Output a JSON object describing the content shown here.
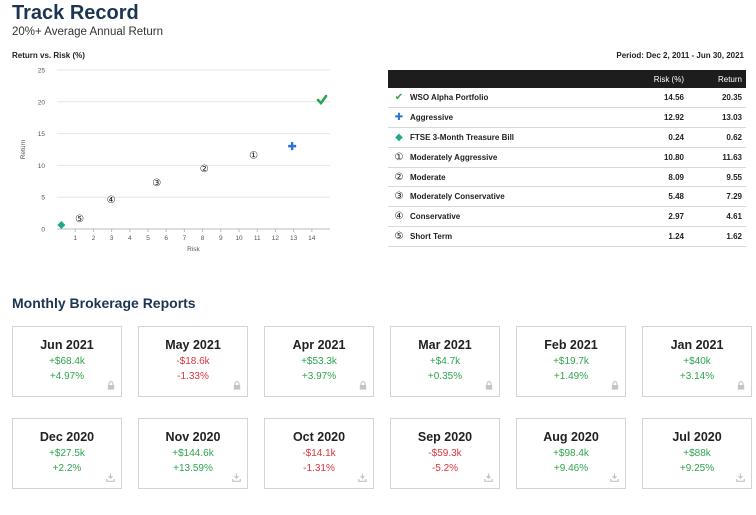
{
  "header": {
    "title": "Track Record",
    "subtitle": "20%+ Average Annual Return"
  },
  "chart_header": {
    "title": "Return vs. Risk (%)",
    "period": "Period: Dec 2, 2011 - Jun 30, 2021"
  },
  "chart_data": {
    "type": "scatter",
    "title": "Return vs. Risk (%)",
    "xlabel": "Risk",
    "ylabel": "Return",
    "xlim": [
      0,
      15
    ],
    "ylim": [
      0,
      25
    ],
    "x_ticks": [
      "1",
      "2",
      "3",
      "4",
      "5",
      "6",
      "7",
      "8",
      "9",
      "10",
      "11",
      "12",
      "13",
      "14"
    ],
    "y_ticks": [
      "0",
      "5",
      "10",
      "15",
      "20",
      "25"
    ],
    "grid": "horizontal",
    "series": [
      {
        "name": "WSO Alpha Portfolio",
        "marker": "check",
        "color": "#2da44e",
        "x": 14.56,
        "y": 20.35
      },
      {
        "name": "Aggressive",
        "marker": "plus",
        "color": "#2f6fd9",
        "x": 12.92,
        "y": 13.03
      },
      {
        "name": "FTSE 3-Month Treasure Bill",
        "marker": "diamond",
        "color": "#1fa88a",
        "x": 0.24,
        "y": 0.62
      },
      {
        "name": "Moderately Aggressive",
        "marker": "①",
        "color": "#111111",
        "x": 10.8,
        "y": 11.63
      },
      {
        "name": "Moderate",
        "marker": "②",
        "color": "#111111",
        "x": 8.09,
        "y": 9.55
      },
      {
        "name": "Moderately Conservative",
        "marker": "③",
        "color": "#111111",
        "x": 5.48,
        "y": 7.29
      },
      {
        "name": "Conservative",
        "marker": "④",
        "color": "#111111",
        "x": 2.97,
        "y": 4.61
      },
      {
        "name": "Short Term",
        "marker": "⑤",
        "color": "#111111",
        "x": 1.24,
        "y": 1.62
      }
    ]
  },
  "table": {
    "col_risk": "Risk (%)",
    "col_return": "Return",
    "rows": [
      {
        "icon": "✔",
        "color": "#2da44e",
        "name": "WSO Alpha Portfolio",
        "risk": "14.56",
        "ret": "20.35"
      },
      {
        "icon": "✚",
        "color": "#2f6fd9",
        "name": "Aggressive",
        "risk": "12.92",
        "ret": "13.03"
      },
      {
        "icon": "◆",
        "color": "#1fa88a",
        "name": "FTSE 3-Month Treasure Bill",
        "risk": "0.24",
        "ret": "0.62"
      },
      {
        "icon": "①",
        "color": "#111111",
        "name": "Moderately Aggressive",
        "risk": "10.80",
        "ret": "11.63"
      },
      {
        "icon": "②",
        "color": "#111111",
        "name": "Moderate",
        "risk": "8.09",
        "ret": "9.55"
      },
      {
        "icon": "③",
        "color": "#111111",
        "name": "Moderately Conservative",
        "risk": "5.48",
        "ret": "7.29"
      },
      {
        "icon": "④",
        "color": "#111111",
        "name": "Conservative",
        "risk": "2.97",
        "ret": "4.61"
      },
      {
        "icon": "⑤",
        "color": "#111111",
        "name": "Short Term",
        "risk": "1.24",
        "ret": "1.62"
      }
    ]
  },
  "reports": {
    "title": "Monthly Brokerage Reports",
    "cards": [
      {
        "month": "Jun 2021",
        "amount": "+$68.4k",
        "pct": "+4.97%",
        "sign": "pos",
        "icon": "lock-icon"
      },
      {
        "month": "May 2021",
        "amount": "-$18.6k",
        "pct": "-1.33%",
        "sign": "neg",
        "icon": "lock-icon"
      },
      {
        "month": "Apr 2021",
        "amount": "+$53.3k",
        "pct": "+3.97%",
        "sign": "pos",
        "icon": "lock-icon"
      },
      {
        "month": "Mar 2021",
        "amount": "+$4.7k",
        "pct": "+0.35%",
        "sign": "pos",
        "icon": "lock-icon"
      },
      {
        "month": "Feb 2021",
        "amount": "+$19.7k",
        "pct": "+1.49%",
        "sign": "pos",
        "icon": "lock-icon"
      },
      {
        "month": "Jan 2021",
        "amount": "+$40k",
        "pct": "+3.14%",
        "sign": "pos",
        "icon": "lock-icon"
      },
      {
        "month": "Dec 2020",
        "amount": "+$27.5k",
        "pct": "+2.2%",
        "sign": "pos",
        "icon": "download-icon"
      },
      {
        "month": "Nov 2020",
        "amount": "+$144.6k",
        "pct": "+13.59%",
        "sign": "pos",
        "icon": "download-icon"
      },
      {
        "month": "Oct 2020",
        "amount": "-$14.1k",
        "pct": "-1.31%",
        "sign": "neg",
        "icon": "download-icon"
      },
      {
        "month": "Sep 2020",
        "amount": "-$59.3k",
        "pct": "-5.2%",
        "sign": "neg",
        "icon": "download-icon"
      },
      {
        "month": "Aug 2020",
        "amount": "+$98.4k",
        "pct": "+9.46%",
        "sign": "pos",
        "icon": "download-icon"
      },
      {
        "month": "Jul 2020",
        "amount": "+$88k",
        "pct": "+9.25%",
        "sign": "pos",
        "icon": "download-icon"
      }
    ]
  }
}
